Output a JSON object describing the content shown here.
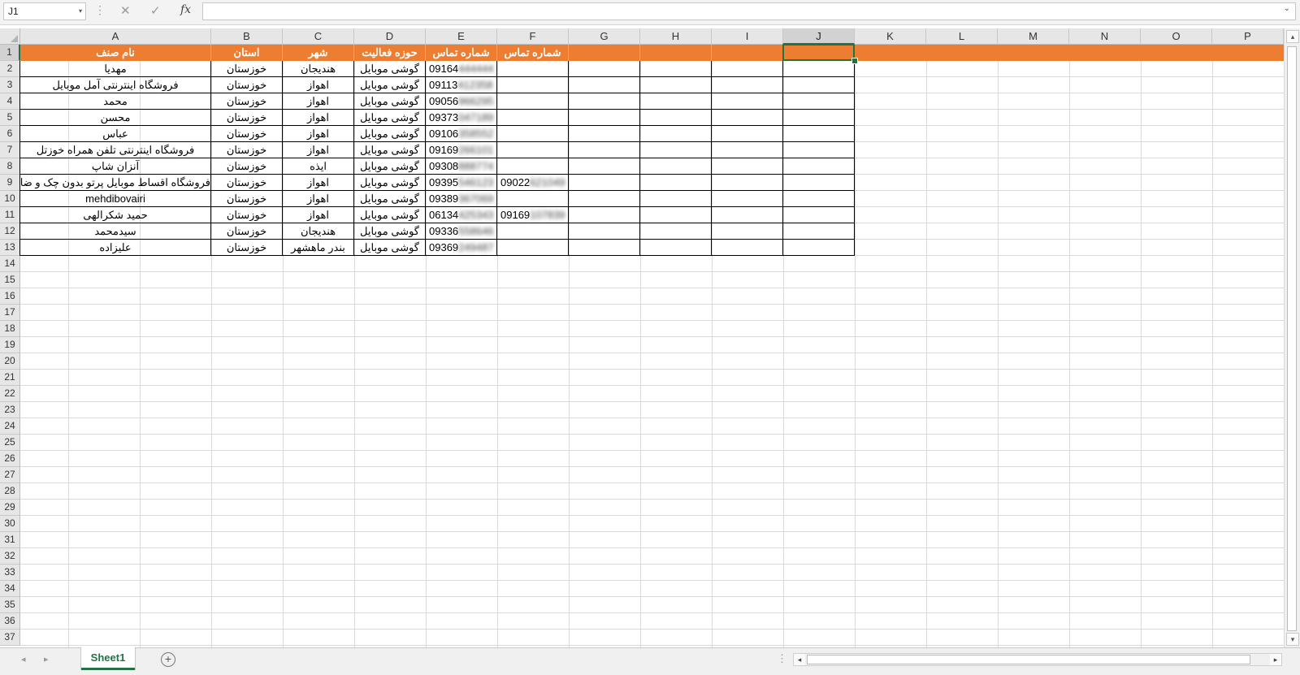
{
  "formula_bar": {
    "name_box": "J1",
    "name_box_arrow_icon": "▾",
    "dots_icon": "⋮",
    "cancel_icon": "✕",
    "enter_icon": "✓",
    "fx_label": "fx",
    "formula_value": "",
    "expand_icon": "⌄"
  },
  "columns": [
    "A",
    "B",
    "C",
    "D",
    "E",
    "F",
    "G",
    "H",
    "I",
    "J",
    "K",
    "L",
    "M",
    "N",
    "O",
    "P"
  ],
  "rows": [
    "1",
    "2",
    "3",
    "4",
    "5",
    "6",
    "7",
    "8",
    "9",
    "10",
    "11",
    "12",
    "13",
    "14",
    "15",
    "16",
    "17",
    "18",
    "19",
    "20",
    "21",
    "22",
    "23",
    "24",
    "25",
    "26",
    "27",
    "28",
    "29",
    "30",
    "31",
    "32",
    "33",
    "34",
    "35",
    "36",
    "37"
  ],
  "headers": [
    "نام صنف",
    "استان",
    "شهر",
    "حوزه فعالیت",
    "شماره تماس",
    "شماره تماس"
  ],
  "data_rows": [
    {
      "name": "مهدیا",
      "province": "خوزستان",
      "city": "هندیجان",
      "field": "گوشی موبایل",
      "phone_visible": "09164",
      "phone_hidden": "444444",
      "phone2_visible": "",
      "phone2_hidden": ""
    },
    {
      "name": "فروشگاه اینترنتی آمل موبایل",
      "province": "خوزستان",
      "city": "اهواز",
      "field": "گوشی موبایل",
      "phone_visible": "09113",
      "phone_hidden": "412358",
      "phone2_visible": "",
      "phone2_hidden": ""
    },
    {
      "name": "محمد",
      "province": "خوزستان",
      "city": "اهواز",
      "field": "گوشی موبایل",
      "phone_visible": "09056",
      "phone_hidden": "966295",
      "phone2_visible": "",
      "phone2_hidden": ""
    },
    {
      "name": "محسن",
      "province": "خوزستان",
      "city": "اهواز",
      "field": "گوشی موبایل",
      "phone_visible": "09373",
      "phone_hidden": "047189",
      "phone2_visible": "",
      "phone2_hidden": ""
    },
    {
      "name": "عباس",
      "province": "خوزستان",
      "city": "اهواز",
      "field": "گوشی موبایل",
      "phone_visible": "09106",
      "phone_hidden": "358552",
      "phone2_visible": "",
      "phone2_hidden": ""
    },
    {
      "name": "فروشگاه اینترنتی تلفن همراه خوزتل",
      "province": "خوزستان",
      "city": "اهواز",
      "field": "گوشی موبایل",
      "phone_visible": "09169",
      "phone_hidden": "266101",
      "phone2_visible": "",
      "phone2_hidden": ""
    },
    {
      "name": "آنزان شاپ",
      "province": "خوزستان",
      "city": "ایذه",
      "field": "گوشی موبایل",
      "phone_visible": "09308",
      "phone_hidden": "888774",
      "phone2_visible": "",
      "phone2_hidden": ""
    },
    {
      "name": "فروشگاه اقساط موبایل پرتو بدون چک و ضامن",
      "province": "خوزستان",
      "city": "اهواز",
      "field": "گوشی موبایل",
      "phone_visible": "09395",
      "phone_hidden": "546123",
      "phone2_visible": "09022",
      "phone2_hidden": "621049"
    },
    {
      "name": "mehdibovairi",
      "province": "خوزستان",
      "city": "اهواز",
      "field": "گوشی موبایل",
      "phone_visible": "09389",
      "phone_hidden": "367069",
      "phone2_visible": "",
      "phone2_hidden": ""
    },
    {
      "name": "حمید شکرالهی",
      "province": "خوزستان",
      "city": "اهواز",
      "field": "گوشی موبایل",
      "phone_visible": "06134",
      "phone_hidden": "425343",
      "phone2_visible": "09169",
      "phone2_hidden": "107839"
    },
    {
      "name": "سیدمحمد",
      "province": "خوزستان",
      "city": "هندیجان",
      "field": "گوشی موبایل",
      "phone_visible": "09336",
      "phone_hidden": "558646",
      "phone2_visible": "",
      "phone2_hidden": ""
    },
    {
      "name": "علیزاده",
      "province": "خوزستان",
      "city": "بندر ماهشهر",
      "field": "گوشی موبایل",
      "phone_visible": "09369",
      "phone_hidden": "249487",
      "phone2_visible": "",
      "phone2_hidden": ""
    }
  ],
  "colors": {
    "header_fill": "#ed7d31",
    "accent": "#217346"
  },
  "sheet_bar": {
    "prev_icon": "◂",
    "next_icon": "▸",
    "tab_label": "Sheet1",
    "add_icon": "+",
    "dots_icon": "⋮",
    "scroll_left_icon": "◂",
    "scroll_right_icon": "▸"
  },
  "vscroll": {
    "up_icon": "▴",
    "down_icon": "▾"
  }
}
